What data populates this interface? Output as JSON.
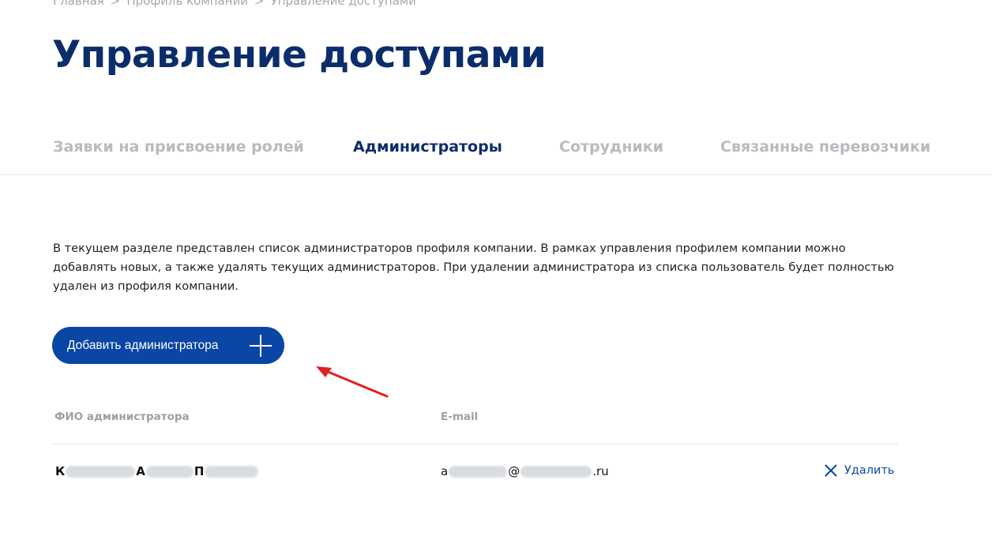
{
  "breadcrumb": {
    "items": [
      "Главная",
      "Профиль компании",
      "Управление доступами"
    ],
    "separator": ">"
  },
  "page": {
    "title": "Управление доступами"
  },
  "tabs": [
    {
      "label": "Заявки на присвоение ролей",
      "active": false
    },
    {
      "label": "Администраторы",
      "active": true
    },
    {
      "label": "Сотрудники",
      "active": false
    },
    {
      "label": "Связанные перевозчики",
      "active": false
    }
  ],
  "description": "В текущем разделе представлен список администраторов профиля компании. В рамках управления профилем компании можно добавлять новых, а также удалять текущих администраторов. При удалении администратора из списка пользователь будет полностью удален из профиля компании.",
  "actions": {
    "add_admin_label": "Добавить администратора"
  },
  "table": {
    "headers": {
      "name": "ФИО администратора",
      "email": "E-mail"
    },
    "rows": [
      {
        "name_parts": [
          "К",
          "А",
          "П"
        ],
        "email_prefix": "a",
        "email_at": "@",
        "email_suffix": ".ru",
        "delete_label": "Удалить"
      }
    ]
  },
  "colors": {
    "primary": "#0a46a5",
    "title": "#0b2d6b",
    "annotation_arrow": "#e02020"
  }
}
